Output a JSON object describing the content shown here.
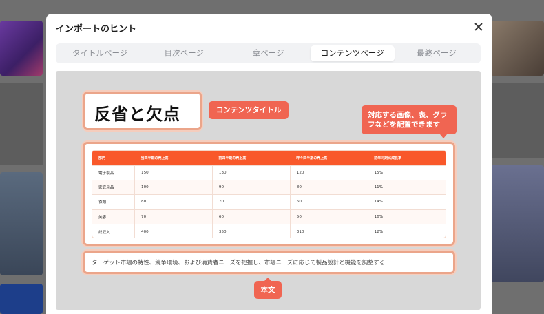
{
  "dialog": {
    "title": "インポートのヒント",
    "close_label": "×"
  },
  "tabs": [
    {
      "label": "タイトルページ",
      "active": false
    },
    {
      "label": "目次ページ",
      "active": false
    },
    {
      "label": "章ページ",
      "active": false
    },
    {
      "label": "コンテンツページ",
      "active": true
    },
    {
      "label": "最終ページ",
      "active": false
    }
  ],
  "preview": {
    "slide_title": "反省と欠点",
    "title_tag": "コンテンツタイトル",
    "media_tag": "対応する画像、表、グラフなどを配置できます",
    "body_tag": "本文",
    "body_text": "ターゲット市場の特性、競争環境、および消費者ニーズを把握し、市場ニーズに応じて製品設計と機能を調整する",
    "table": {
      "headers": [
        "部門",
        "当四半期の売上高",
        "前四半期の売上高",
        "昨々四半期の売上高",
        "前年同期比成長率"
      ],
      "rows": [
        [
          "電子製品",
          "150",
          "130",
          "120",
          "15%"
        ],
        [
          "家庭用品",
          "100",
          "90",
          "80",
          "11%"
        ],
        [
          "衣類",
          "80",
          "70",
          "60",
          "14%"
        ],
        [
          "美容",
          "70",
          "60",
          "50",
          "16%"
        ],
        [
          "総収入",
          "400",
          "350",
          "310",
          "12%"
        ]
      ]
    }
  },
  "colors": {
    "accent": "#f06552",
    "table_header": "#f9582a",
    "highlight_border": "#eba58a"
  }
}
